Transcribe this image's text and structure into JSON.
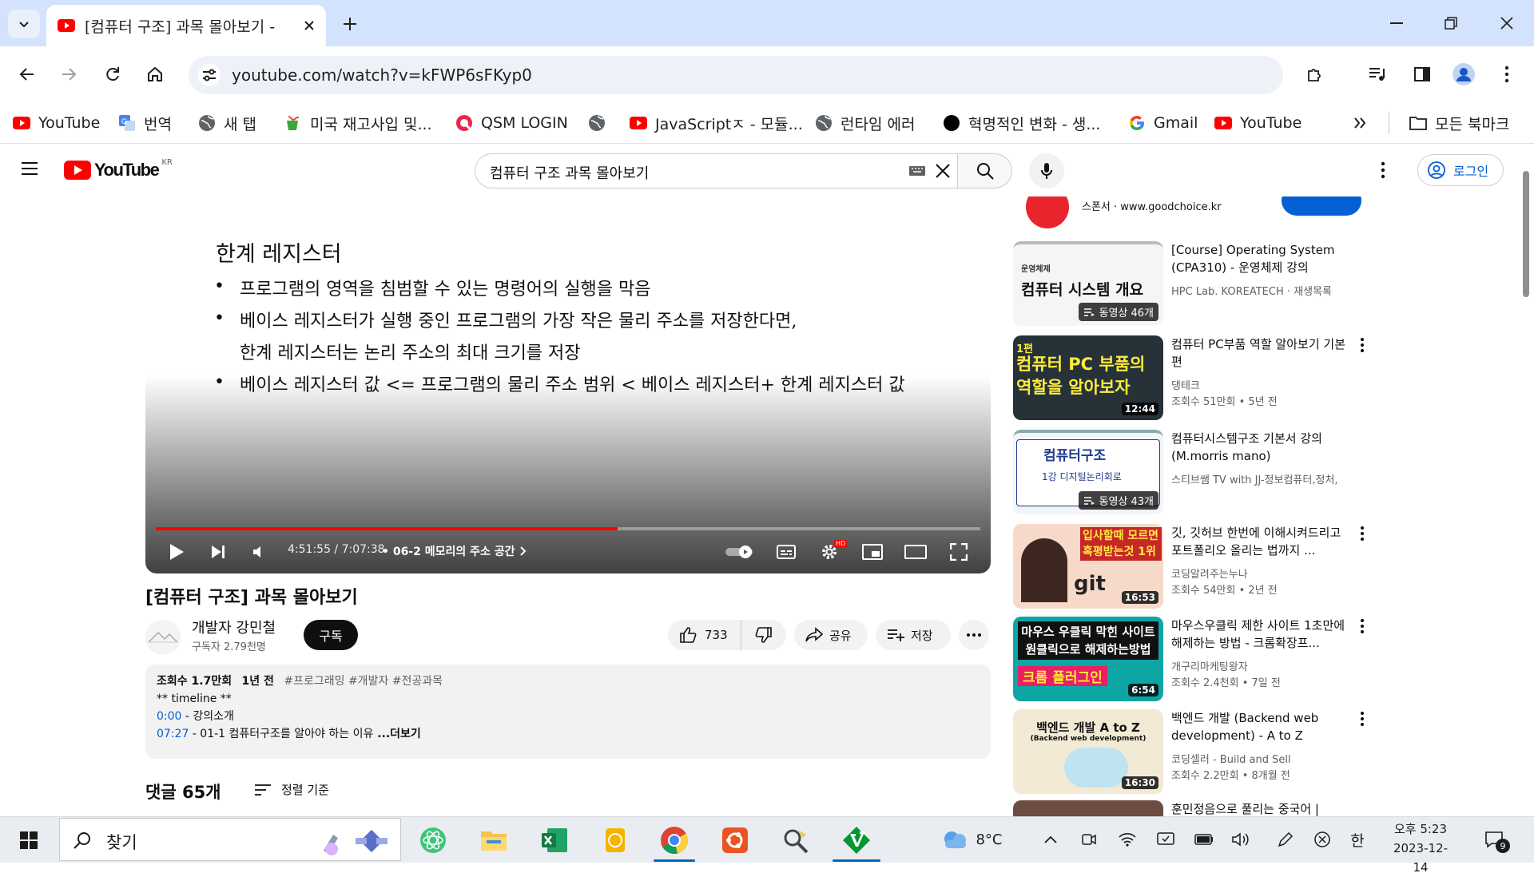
{
  "browser": {
    "tab_title": "[컴퓨터 구조] 과목 몰아보기 -",
    "url": "youtube.com/watch?v=kFWP6sFKyp0",
    "bookmarks": [
      {
        "label": "YouTube",
        "icon": "youtube-icon"
      },
      {
        "label": "번역",
        "icon": "translate-icon"
      },
      {
        "label": "새 탭",
        "icon": "globe-icon"
      },
      {
        "label": "미국 재고사입 및...",
        "icon": "cup-icon"
      },
      {
        "label": "QSM LOGIN",
        "icon": "qsm-icon"
      },
      {
        "label": "",
        "icon": "globe-icon"
      },
      {
        "label": "JavaScriptㅈ - 모듈...",
        "icon": "youtube-icon"
      },
      {
        "label": "런타임 에러",
        "icon": "globe-icon"
      },
      {
        "label": "혁명적인 변화 - 생...",
        "icon": "dot-icon"
      },
      {
        "label": "Gmail",
        "icon": "google-icon"
      },
      {
        "label": "YouTube",
        "icon": "youtube-icon"
      }
    ],
    "all_bookmarks": "모든 북마크"
  },
  "youtube": {
    "region": "KR",
    "logo_text": "YouTube",
    "search_query": "컴퓨터 구조 과목 몰아보기",
    "login_label": "로그인"
  },
  "slide": {
    "title": "한계 레지스터",
    "lines": [
      "프로그램의 영역을 침범할 수 있는 명령어의 실행을 막음",
      "베이스 레지스터가 실행 중인 프로그램의 가장 작은 물리 주소를 저장한다면,",
      "한계 레지스터는 논리 주소의 최대 크기를 저장",
      "베이스 레지스터 값 <= 프로그램의 물리 주소 범위 < 베이스 레지스터+ 한계 레지스터 값"
    ]
  },
  "player": {
    "time": "4:51:55 / 7:07:38",
    "chapter": "• 06-2 메모리의 주소 공간",
    "progress": 0.56
  },
  "video": {
    "title": "[컴퓨터 구조] 과목 몰아보기",
    "channel": "개발자 강민철",
    "subscribers": "구독자 2.79천명",
    "subscribe_label": "구독",
    "likes": "733",
    "share_label": "공유",
    "save_label": "저장"
  },
  "description": {
    "views": "조회수 1.7만회",
    "date": "1년 전",
    "tags": "#프로그래밍 #개발자 #전공과목",
    "line2": "** timeline **",
    "ts1": "0:00",
    "ts1_text": " - 강의소개",
    "ts2": "07:27",
    "ts2_text": " - 01-1 컴퓨터구조를 알아야 하는 이유",
    "more": " ...더보기"
  },
  "comments": {
    "count": "댓글 65개",
    "sort": "정렬 기준"
  },
  "sidebar": {
    "ad": {
      "label": "스폰서 · www.goodchoice.kr"
    },
    "items": [
      {
        "title": "[Course] Operating System (CPA310) - 운영체제 강의",
        "channel": "HPC Lab. KOREATECH · 재생목록",
        "meta": "",
        "badge": "동영상 46개",
        "thumb_text": "컴퓨터 시스템 개요",
        "thumb_sub": "운영체제"
      },
      {
        "title": "컴퓨터 PC부품 역할 알아보기 기본편",
        "channel": "댕테크",
        "meta": "조회수 51만회 • 5년 전",
        "badge": "12:44",
        "thumb_text": "컴퓨터 PC 부품의 역할을 알아보자",
        "thumb_sub": "1편"
      },
      {
        "title": "컴퓨터시스템구조 기본서 강의(M.morris mano)",
        "channel": "스티브쌤 TV with JJ-정보컴퓨터,정처,",
        "meta": "",
        "badge": "동영상 43개",
        "thumb_text": "컴퓨터구조",
        "thumb_sub": "1강 디지털논리회로"
      },
      {
        "title": "깃, 깃허브 한번에 이해시켜드리고 포트폴리오 올리는 법까지 ...",
        "channel": "코딩알려주는누나",
        "meta": "조회수 54만회 • 2년 전",
        "badge": "16:53",
        "thumb_text": "입사할때 모르면 혹평받는것 1위",
        "thumb_sub": "git"
      },
      {
        "title": "마우스우클릭 제한 사이트 1초만에 해제하는 방법 - 크롬확장프...",
        "channel": "개구리마케팅왕자",
        "meta": "조회수 2.4천회 • 7일 전",
        "badge": "6:54",
        "thumb_text": "마우스 우클릭 막힌 사이트 원클릭으로 해제하는방법",
        "thumb_sub": "크롬 플러그인"
      },
      {
        "title": "백엔드 개발 (Backend web development) - A to Z",
        "channel": "코딩셀러 - Build and Sell",
        "meta": "조회수 2.2만회 • 8개월 전",
        "badge": "16:30",
        "thumb_text": "백엔드 개발 A to Z",
        "thumb_sub": "(Backend web development)"
      },
      {
        "title": "훈민정음으로 풀리는 중국어 |",
        "channel": "",
        "meta": "",
        "badge": "",
        "thumb_text": "",
        "thumb_sub": ""
      }
    ]
  },
  "taskbar": {
    "search_placeholder": "찾기",
    "weather": "8°C",
    "ime": "한",
    "time": "오후 5:23",
    "date": "2023-12-14",
    "notifications": "9"
  },
  "colors": {
    "youtube_red": "#ff0000",
    "link_blue": "#065fd4",
    "chrome_tabstrip": "#d3e3fd"
  }
}
